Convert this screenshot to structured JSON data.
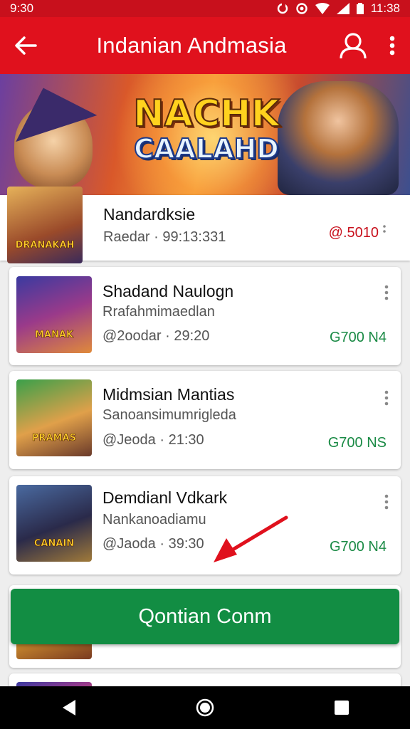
{
  "status_bar": {
    "time_left": "9:30",
    "time_right": "11:38"
  },
  "app_bar": {
    "title": "Indanian Andmasia"
  },
  "banner": {
    "logo_line1": "NACHK",
    "logo_line2": "CAALAHD"
  },
  "items": [
    {
      "title": "Nandardksie",
      "subtitle": "",
      "meta": "Raedar · 99:13:331",
      "price": "@.5010",
      "price_color": "#c8101c",
      "thumb_label": "DRANAKAH"
    },
    {
      "title": "Shadand Naulogn",
      "subtitle": "Rrafahmimaedlan",
      "meta": "@2oodar · 29:20",
      "price": "G700 N4",
      "price_color": "#1a8a45",
      "thumb_label": "MANAK"
    },
    {
      "title": "Midmsian Mantias",
      "subtitle": "Sanoansimumrigleda",
      "meta": "@Jeoda · 21:30",
      "price": "G700 NS",
      "price_color": "#1a8a45",
      "thumb_label": "PRAMAS"
    },
    {
      "title": "Demdianl Vdkark",
      "subtitle": "Nankanoadiamu",
      "meta": "@Jaoda · 39:30",
      "price": "G700 N4",
      "price_color": "#1a8a45",
      "thumb_label": "CANAIN"
    }
  ],
  "cta": {
    "label": "Qontian Conm"
  },
  "colors": {
    "app_bar": "#e0111d",
    "status_bar": "#c8101c",
    "cta": "#128d43",
    "price_green": "#1a8a45",
    "arrow": "#e0111d"
  },
  "icons": {
    "back": "arrow-left-icon",
    "account": "user-icon",
    "overflow": "more-vertical-icon"
  }
}
